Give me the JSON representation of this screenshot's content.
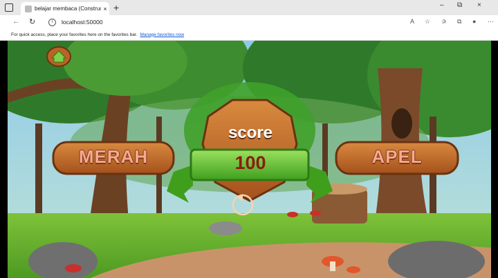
{
  "browser": {
    "tab_title": "belajar membaca (Construct",
    "tab_close": "×",
    "new_tab": "+",
    "url": "localhost:50000",
    "favorites_message": "For quick access, place your favorites here on the favorites bar.",
    "favorites_link": "Manage favorites now",
    "window_controls": [
      "–",
      "⧉",
      "×"
    ]
  },
  "game": {
    "left_word": "MERAH",
    "right_word": "APEL",
    "score_label": "score",
    "score_value": "100"
  },
  "colors": {
    "wood": "#b96326",
    "wood_dark": "#7a3b13",
    "ribbon": "#5cc12c",
    "score_text": "#8a1c0c",
    "word_text": "#f7a890"
  }
}
